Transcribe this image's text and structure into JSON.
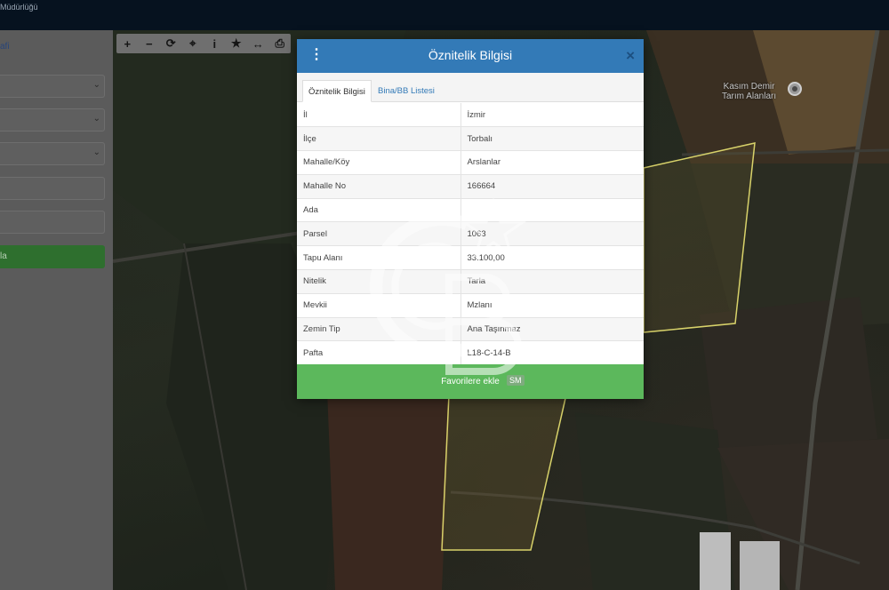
{
  "app": {
    "brand_text": "Müdürlüğü"
  },
  "left_panel": {
    "link_text": "afi",
    "query_button_label": "la"
  },
  "map_toolbar": {
    "tools": [
      {
        "name": "zoom-in-icon",
        "glyph": "+"
      },
      {
        "name": "zoom-out-icon",
        "glyph": "−"
      },
      {
        "name": "refresh-icon",
        "glyph": "⟳"
      },
      {
        "name": "locate-icon",
        "glyph": "⌖"
      },
      {
        "name": "info-icon",
        "glyph": "i"
      },
      {
        "name": "star-icon",
        "glyph": "★"
      },
      {
        "name": "measure-icon",
        "glyph": "↔"
      },
      {
        "name": "print-icon",
        "glyph": "⎙"
      }
    ]
  },
  "map": {
    "poi_label_line1": "Kasım Demir",
    "poi_label_line2": "Tarım Alanları",
    "parcel_outline_color": "#d8d26a"
  },
  "modal": {
    "title": "Öznitelik Bilgisi",
    "close_glyph": "×",
    "menu_glyph": "⋮",
    "header_color": "#337ab7",
    "tabs": [
      {
        "label": "Öznitelik Bilgisi",
        "active": true
      },
      {
        "label": "Bina/BB Listesi",
        "active": false
      }
    ],
    "rows": [
      {
        "key": "İl",
        "value": "İzmir"
      },
      {
        "key": "İlçe",
        "value": "Torbalı"
      },
      {
        "key": "Mahalle/Köy",
        "value": "Arslanlar"
      },
      {
        "key": "Mahalle No",
        "value": "166664"
      },
      {
        "key": "Ada",
        "value": ""
      },
      {
        "key": "Parsel",
        "value": "1063"
      },
      {
        "key": "Tapu Alanı",
        "value": "33.100,00"
      },
      {
        "key": "Nitelik",
        "value": "Tarla"
      },
      {
        "key": "Mevkii",
        "value": "Mzlanı"
      },
      {
        "key": "Zemin Tip",
        "value": "Ana Taşınmaz"
      },
      {
        "key": "Pafta",
        "value": "L18-C-14-B"
      }
    ],
    "favorite_button_label": "Favorilere ekle",
    "favorite_button_color": "#5cb85c"
  },
  "watermark": {
    "badge_text": "SM"
  }
}
